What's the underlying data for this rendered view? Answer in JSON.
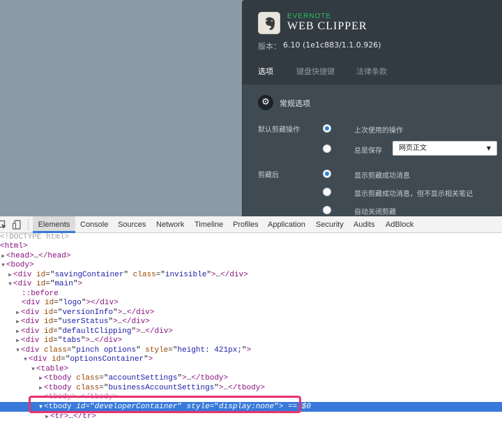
{
  "popup": {
    "brand_top": "EVERNOTE",
    "brand_main": "WEB CLIPPER",
    "version_label": "版本：",
    "version_value": "6.10 (1e1c883/1.1.0.926)",
    "tabs": [
      {
        "label": "选项",
        "active": true
      },
      {
        "label": "键盘快捷键",
        "active": false
      },
      {
        "label": "法律条款",
        "active": false
      }
    ],
    "section_title": "常规选项",
    "default_clip_label": "默认剪藏操作",
    "default_clip_options": [
      "上次使用的操作",
      "总是保存"
    ],
    "save_select_value": "网页正文",
    "after_clip_label": "剪藏后",
    "after_clip_options": [
      "显示剪藏成功消息",
      "显示剪藏成功消息，但不显示相关笔记",
      "自动关闭剪藏"
    ]
  },
  "devtools": {
    "tabs": [
      "Elements",
      "Console",
      "Sources",
      "Network",
      "Timeline",
      "Profiles",
      "Application",
      "Security",
      "Audits",
      "AdBlock"
    ],
    "active_tab": "Elements",
    "tree": {
      "doctype": "<!DOCTYPE html>",
      "l_html": "html",
      "l_head": "head",
      "l_head_close": "</head>",
      "l_body": "body",
      "div": "div",
      "tbody": "tbody",
      "table": "table",
      "ellipsis": "…",
      "div_close": "</div>",
      "tbody_close": "</tbody>",
      "tr_close": "</tr>",
      "attr_id": "id",
      "attr_class": "class",
      "attr_style": "style",
      "savingContainer": "savingContainer",
      "invisible": "invisible",
      "main": "main",
      "before": "::before",
      "logo": "logo",
      "versionInfo": "versionInfo",
      "userStatus": "userStatus",
      "defaultClipping": "defaultClipping",
      "tabs": "tabs",
      "pinch_options": "pinch options",
      "height_style": "height: 421px;",
      "optionsContainer": "optionsContainer",
      "accountSettings": "accountSettings",
      "businessAccountSettings": "businessAccountSettings",
      "developerContainer": "developerContainer",
      "display_none": "display:none",
      "eq": "== $0",
      "tr": "tr"
    }
  },
  "colors": {
    "evernote_green": "#2dbe60",
    "selection_blue": "#3879d9",
    "highlight_pink": "#e8336b"
  }
}
